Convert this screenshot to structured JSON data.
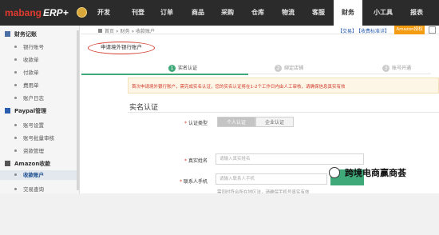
{
  "header": {
    "logo_brand": "mabang",
    "logo_product": "ERP+",
    "nav": [
      {
        "label": "开发"
      },
      {
        "label": "刊登"
      },
      {
        "label": "订单"
      },
      {
        "label": "商品"
      },
      {
        "label": "采购"
      },
      {
        "label": "仓库"
      },
      {
        "label": "物流"
      },
      {
        "label": "客服"
      },
      {
        "label": "财务",
        "active": true
      },
      {
        "label": "小工具"
      },
      {
        "label": "报表"
      }
    ]
  },
  "sidebar": {
    "sections": [
      {
        "title": "财务记账",
        "items": [
          "银行账号",
          "收款单",
          "付款单",
          "费用单",
          "账户日志"
        ]
      },
      {
        "title": "Paypal管理",
        "items": [
          "账号设置",
          "账号批量审核",
          "资款管理"
        ]
      },
      {
        "title": "Amazon收款",
        "items": [
          "收款账户",
          "交易查询"
        ],
        "active_item": "收款账户"
      }
    ]
  },
  "breadcrumb": {
    "items": [
      "首页",
      "财务",
      "收款账户"
    ],
    "links": [
      "【交易】",
      "【收费标准详】"
    ],
    "amazon_button": "Amazon授权"
  },
  "page_title": "申请境外银行账户",
  "steps": [
    {
      "num": "1",
      "label": "实名认证",
      "active": true
    },
    {
      "num": "2",
      "label": "绑定店铺",
      "active": false
    },
    {
      "num": "3",
      "label": "账号开通",
      "active": false
    }
  ],
  "notice": "首次申请境外银行账户，需完成实名认证，您的实名认证将在1-2个工作日内由人工审核，请确保信息真实有效",
  "form": {
    "section_title": "实名认证",
    "auth_type_label": "认证类型",
    "auth_type_options": [
      "个人认证",
      "企业认证"
    ],
    "auth_type_selected": "个人认证",
    "real_name_label": "真实姓名",
    "real_name_placeholder": "请输入真实姓名",
    "phone_label": "联系人手机",
    "phone_placeholder": "请输入联系人手机",
    "phone_hint": "需同时符合所在地区法，请确保手机号真实有效"
  },
  "watermark": "跨境电商赢商荟",
  "colors": {
    "topbar": "#2b2b2b",
    "accent_green": "#3fa97a",
    "notice_text": "#d23a2a",
    "highlight_circle": "#d23a2a"
  }
}
